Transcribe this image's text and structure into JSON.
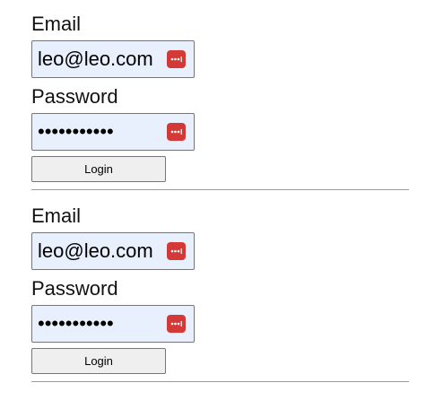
{
  "forms": [
    {
      "email_label": "Email",
      "email_value": "leo@leo.com",
      "password_label": "Password",
      "password_value": "•••••••••••",
      "login_label": "Login"
    },
    {
      "email_label": "Email",
      "email_value": "leo@leo.com",
      "password_label": "Password",
      "password_value": "•••••••••••",
      "login_label": "Login"
    }
  ],
  "icons": {
    "password_manager": "password-manager-icon"
  },
  "colors": {
    "autofill_background": "#e8f0fe",
    "password_manager_icon": "#d33a37",
    "button_background": "#efefef",
    "divider": "#9a9a9a"
  }
}
